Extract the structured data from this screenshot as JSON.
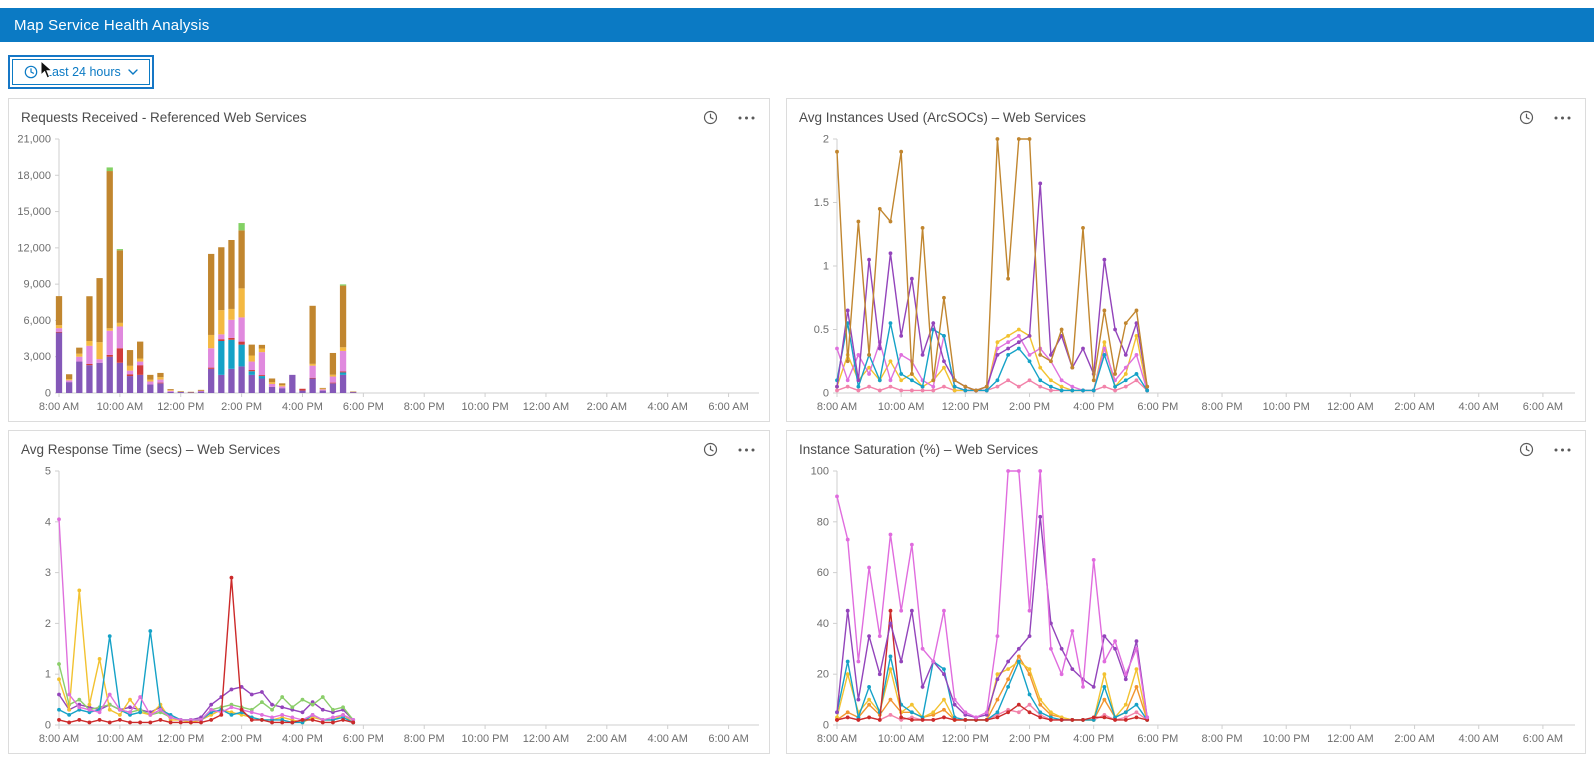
{
  "app": {
    "title": "Map Service Health Analysis"
  },
  "colors": {
    "header_bg": "#0b7ac4",
    "accent": "#0b7ac4",
    "axis": "#cfcfcf",
    "tick_text": "#6e6e6e"
  },
  "toolbar": {
    "time_filter_label": "Last 24 hours",
    "icons": {
      "clock": "clock-icon",
      "dropdown": "chevron-down-icon"
    }
  },
  "panel_icons": {
    "time": "clock-icon",
    "menu": "ellipsis-icon"
  },
  "chart_data": [
    {
      "type": "stacked-bar",
      "title": "Requests Received - Referenced Web Services",
      "ylim": [
        0,
        21000
      ],
      "yticks": [
        0,
        3000,
        6000,
        9000,
        12000,
        15000,
        18000,
        21000
      ],
      "ytick_labels": [
        "0",
        "3,000",
        "6,000",
        "9,000",
        "12,000",
        "15,000",
        "18,000",
        "21,000"
      ],
      "xtick_labels": [
        "8:00 AM",
        "10:00 AM",
        "12:00 PM",
        "2:00 PM",
        "4:00 PM",
        "6:00 PM",
        "8:00 PM",
        "10:00 PM",
        "12:00 AM",
        "2:00 AM",
        "4:00 AM",
        "6:00 AM"
      ],
      "tick_every": 12,
      "x_slots": 139,
      "data_start_slot": 0,
      "data_step": 2,
      "legend": "hidden",
      "grid": false,
      "series": [
        {
          "name": "purple",
          "color": "#8458b8",
          "values": [
            5000,
            900,
            2600,
            2300,
            2500,
            3000,
            2500,
            1400,
            1500,
            700,
            800,
            100,
            80,
            60,
            120,
            2000,
            1500,
            2000,
            2200,
            1500,
            1200,
            500,
            400,
            1500,
            200,
            1200,
            200,
            800,
            1500,
            80
          ]
        },
        {
          "name": "teal",
          "color": "#15a2c7",
          "values": [
            0,
            0,
            0,
            0,
            0,
            0,
            0,
            0,
            0,
            0,
            0,
            0,
            0,
            0,
            0,
            0,
            2800,
            2400,
            1800,
            300,
            200,
            0,
            0,
            0,
            0,
            0,
            0,
            0,
            200,
            0
          ]
        },
        {
          "name": "red",
          "color": "#d13b3b",
          "values": [
            60,
            0,
            0,
            100,
            0,
            150,
            1200,
            150,
            800,
            0,
            60,
            0,
            0,
            0,
            0,
            100,
            150,
            150,
            250,
            100,
            80,
            0,
            0,
            0,
            150,
            60,
            0,
            60,
            80,
            0
          ]
        },
        {
          "name": "orchid",
          "color": "#e089de",
          "values": [
            300,
            150,
            400,
            1500,
            300,
            2000,
            1800,
            300,
            300,
            250,
            250,
            80,
            0,
            0,
            60,
            1600,
            400,
            1500,
            2000,
            700,
            1900,
            250,
            150,
            0,
            0,
            1000,
            100,
            500,
            1700,
            0
          ]
        },
        {
          "name": "yellow",
          "color": "#f4b942",
          "values": [
            250,
            100,
            250,
            400,
            1400,
            200,
            300,
            400,
            250,
            150,
            200,
            60,
            0,
            0,
            0,
            1100,
            2000,
            900,
            2400,
            500,
            300,
            150,
            100,
            0,
            0,
            150,
            60,
            150,
            300,
            0
          ]
        },
        {
          "name": "tan",
          "color": "#c1862f",
          "values": [
            2400,
            400,
            500,
            3700,
            5300,
            13000,
            6000,
            1300,
            1400,
            400,
            350,
            80,
            60,
            40,
            80,
            6700,
            5200,
            5700,
            4800,
            900,
            300,
            300,
            150,
            0,
            0,
            4800,
            60,
            1800,
            5100,
            40
          ]
        },
        {
          "name": "green",
          "color": "#83d164",
          "values": [
            0,
            0,
            0,
            0,
            0,
            300,
            100,
            0,
            0,
            0,
            0,
            0,
            0,
            0,
            0,
            0,
            0,
            0,
            600,
            0,
            0,
            0,
            0,
            0,
            0,
            0,
            0,
            0,
            100,
            0
          ]
        }
      ]
    },
    {
      "type": "line",
      "title": "Avg Instances Used (ArcSOCs) – Web Services",
      "ylim": [
        0,
        2
      ],
      "yticks": [
        0,
        0.5,
        1,
        1.5,
        2
      ],
      "ytick_labels": [
        "0",
        "0.5",
        "1",
        "1.5",
        "2"
      ],
      "xtick_labels": [
        "8:00 AM",
        "10:00 AM",
        "12:00 PM",
        "2:00 PM",
        "4:00 PM",
        "6:00 PM",
        "8:00 PM",
        "10:00 PM",
        "12:00 AM",
        "2:00 AM",
        "4:00 AM",
        "6:00 AM"
      ],
      "tick_every": 12,
      "x_slots": 139,
      "data_start_slot": 0,
      "data_step": 2,
      "legend": "hidden",
      "grid": false,
      "series": [
        {
          "name": "pink",
          "color": "#f283aa",
          "values": [
            0.02,
            0.05,
            0.02,
            0.05,
            0.02,
            0.05,
            0.02,
            0.02,
            0.02,
            0.02,
            0.05,
            0.02,
            0.02,
            0.02,
            0.02,
            0.05,
            0.1,
            0.05,
            0.1,
            0.05,
            0.02,
            0.02,
            0.02,
            0.02,
            0.02,
            0.05,
            0.02,
            0.05,
            0.1,
            0.02
          ]
        },
        {
          "name": "yellow",
          "color": "#f2c230",
          "values": [
            0.05,
            0.3,
            0.1,
            0.2,
            0.1,
            0.25,
            0.1,
            0.15,
            0.05,
            0.1,
            0.2,
            0.02,
            0.02,
            0.02,
            0.02,
            0.4,
            0.45,
            0.5,
            0.45,
            0.2,
            0.1,
            0.05,
            0.02,
            0.02,
            0.02,
            0.4,
            0.05,
            0.15,
            0.45,
            0.02
          ]
        },
        {
          "name": "magenta",
          "color": "#df70dd",
          "values": [
            0.35,
            0.1,
            0.3,
            0.15,
            0.4,
            0.1,
            0.3,
            0.25,
            0.1,
            0.05,
            0.45,
            0.05,
            0.02,
            0.02,
            0.02,
            0.35,
            0.4,
            0.45,
            0.3,
            0.35,
            0.25,
            0.1,
            0.05,
            0.02,
            0.02,
            0.35,
            0.1,
            0.2,
            0.3,
            0.02
          ]
        },
        {
          "name": "teal",
          "color": "#15a2c7",
          "values": [
            0.1,
            0.55,
            0.05,
            0.3,
            0.1,
            0.55,
            0.15,
            0.1,
            0.05,
            0.5,
            0.45,
            0.05,
            0.02,
            0.02,
            0.02,
            0.1,
            0.3,
            0.35,
            0.25,
            0.1,
            0.05,
            0.02,
            0.02,
            0.02,
            0.02,
            0.3,
            0.05,
            0.1,
            0.15,
            0.02
          ]
        },
        {
          "name": "purple",
          "color": "#9344bb",
          "values": [
            0.05,
            0.65,
            0.1,
            1.05,
            0.35,
            1.1,
            0.45,
            0.9,
            0.3,
            0.55,
            0.25,
            0.1,
            0.05,
            0.02,
            0.05,
            0.3,
            0.35,
            0.4,
            0.45,
            1.65,
            0.3,
            0.45,
            0.2,
            0.35,
            0.15,
            1.05,
            0.5,
            0.3,
            0.55,
            0.05
          ]
        },
        {
          "name": "tan",
          "color": "#c1862f",
          "values": [
            1.9,
            0.25,
            1.35,
            0.3,
            1.45,
            1.35,
            1.9,
            0.15,
            1.3,
            0.1,
            0.75,
            0.1,
            0.05,
            0.02,
            0.05,
            2.0,
            0.9,
            2.0,
            2.0,
            0.3,
            0.25,
            0.5,
            0.2,
            1.3,
            0.1,
            0.65,
            0.15,
            0.55,
            0.65,
            0.05
          ]
        }
      ]
    },
    {
      "type": "line",
      "title": "Avg Response Time (secs) – Web Services",
      "ylim": [
        0,
        5
      ],
      "yticks": [
        0,
        1,
        2,
        3,
        4,
        5
      ],
      "ytick_labels": [
        "0",
        "1",
        "2",
        "3",
        "4",
        "5"
      ],
      "xtick_labels": [
        "8:00 AM",
        "10:00 AM",
        "12:00 PM",
        "2:00 PM",
        "4:00 PM",
        "6:00 PM",
        "8:00 PM",
        "10:00 PM",
        "12:00 AM",
        "2:00 AM",
        "4:00 AM",
        "6:00 AM"
      ],
      "tick_every": 12,
      "x_slots": 139,
      "data_start_slot": 0,
      "data_step": 2,
      "legend": "hidden",
      "grid": false,
      "series": [
        {
          "name": "purple",
          "color": "#9344bb",
          "values": [
            0.6,
            0.3,
            0.4,
            0.35,
            0.3,
            0.4,
            0.3,
            0.35,
            0.3,
            0.25,
            0.35,
            0.15,
            0.1,
            0.1,
            0.15,
            0.4,
            0.55,
            0.7,
            0.75,
            0.6,
            0.65,
            0.4,
            0.35,
            0.3,
            0.25,
            0.45,
            0.3,
            0.25,
            0.3,
            0.1
          ]
        },
        {
          "name": "green",
          "color": "#8bce6a",
          "values": [
            1.2,
            0.4,
            0.5,
            0.3,
            0.35,
            0.4,
            0.3,
            0.25,
            0.3,
            0.2,
            0.25,
            0.15,
            0.1,
            0.1,
            0.1,
            0.3,
            0.35,
            0.4,
            0.35,
            0.3,
            0.45,
            0.3,
            0.55,
            0.35,
            0.5,
            0.4,
            0.55,
            0.3,
            0.35,
            0.1
          ]
        },
        {
          "name": "yellow",
          "color": "#f2c230",
          "values": [
            0.9,
            0.3,
            2.65,
            0.4,
            1.3,
            0.3,
            0.2,
            0.5,
            0.25,
            0.2,
            0.4,
            0.1,
            0.1,
            0.05,
            0.1,
            0.2,
            0.3,
            0.25,
            0.2,
            0.15,
            0.1,
            0.1,
            0.15,
            0.1,
            0.05,
            0.15,
            0.1,
            0.1,
            0.2,
            0.05
          ]
        },
        {
          "name": "teal",
          "color": "#15a2c7",
          "values": [
            0.3,
            0.2,
            0.3,
            0.25,
            0.3,
            1.75,
            0.3,
            0.2,
            0.25,
            1.85,
            0.3,
            0.2,
            0.1,
            0.1,
            0.1,
            0.25,
            0.3,
            0.2,
            0.25,
            0.15,
            0.1,
            0.1,
            0.1,
            0.05,
            0.05,
            0.2,
            0.1,
            0.1,
            0.15,
            0.05
          ]
        },
        {
          "name": "magenta",
          "color": "#df70dd",
          "values": [
            4.05,
            0.6,
            0.35,
            0.3,
            0.25,
            0.6,
            0.3,
            0.25,
            0.55,
            0.2,
            0.3,
            0.15,
            0.1,
            0.1,
            0.1,
            0.3,
            0.25,
            0.35,
            0.3,
            0.25,
            0.2,
            0.15,
            0.2,
            0.15,
            0.1,
            0.2,
            0.1,
            0.15,
            0.2,
            0.1
          ]
        },
        {
          "name": "red",
          "color": "#cc2a2a",
          "values": [
            0.1,
            0.05,
            0.1,
            0.05,
            0.1,
            0.05,
            0.1,
            0.05,
            0.05,
            0.05,
            0.1,
            0.05,
            0.05,
            0.05,
            0.05,
            0.1,
            0.2,
            2.9,
            0.3,
            0.1,
            0.1,
            0.05,
            0.05,
            0.05,
            0.1,
            0.1,
            0.05,
            0.05,
            0.1,
            0.05
          ]
        }
      ]
    },
    {
      "type": "line",
      "title": "Instance Saturation (%) – Web Services",
      "ylim": [
        0,
        100
      ],
      "yticks": [
        0,
        20,
        40,
        60,
        80,
        100
      ],
      "ytick_labels": [
        "0",
        "20",
        "40",
        "60",
        "80",
        "100"
      ],
      "xtick_labels": [
        "8:00 AM",
        "10:00 AM",
        "12:00 PM",
        "2:00 PM",
        "4:00 PM",
        "6:00 PM",
        "8:00 PM",
        "10:00 PM",
        "12:00 AM",
        "2:00 AM",
        "4:00 AM",
        "6:00 AM"
      ],
      "tick_every": 12,
      "x_slots": 139,
      "data_start_slot": 0,
      "data_step": 2,
      "legend": "hidden",
      "grid": false,
      "series": [
        {
          "name": "pink",
          "color": "#f283aa",
          "values": [
            2,
            3,
            2,
            3,
            2,
            4,
            2,
            3,
            2,
            2,
            3,
            2,
            2,
            2,
            2,
            4,
            6,
            5,
            8,
            4,
            2,
            2,
            2,
            2,
            2,
            4,
            2,
            3,
            5,
            2
          ]
        },
        {
          "name": "orange",
          "color": "#f2952f",
          "values": [
            2,
            5,
            3,
            8,
            4,
            10,
            5,
            5,
            3,
            4,
            6,
            2,
            2,
            2,
            2,
            10,
            18,
            27,
            20,
            8,
            4,
            3,
            2,
            2,
            2,
            10,
            3,
            5,
            15,
            2
          ]
        },
        {
          "name": "yellow",
          "color": "#f2c230",
          "values": [
            3,
            20,
            5,
            10,
            5,
            22,
            5,
            8,
            3,
            5,
            10,
            2,
            2,
            2,
            2,
            20,
            22,
            25,
            22,
            10,
            5,
            3,
            2,
            2,
            2,
            20,
            3,
            8,
            22,
            2
          ]
        },
        {
          "name": "teal",
          "color": "#15a2c7",
          "values": [
            5,
            25,
            3,
            15,
            5,
            27,
            8,
            5,
            3,
            25,
            22,
            3,
            2,
            2,
            2,
            5,
            15,
            25,
            12,
            5,
            3,
            2,
            2,
            2,
            2,
            15,
            3,
            5,
            8,
            2
          ]
        },
        {
          "name": "red",
          "color": "#cc2a2a",
          "values": [
            2,
            3,
            2,
            3,
            2,
            45,
            3,
            2,
            2,
            2,
            3,
            2,
            2,
            2,
            2,
            3,
            5,
            8,
            5,
            3,
            2,
            2,
            2,
            2,
            3,
            3,
            2,
            2,
            3,
            2
          ]
        },
        {
          "name": "purple",
          "color": "#9344bb",
          "values": [
            5,
            45,
            10,
            35,
            20,
            40,
            25,
            45,
            15,
            25,
            20,
            8,
            4,
            3,
            4,
            18,
            25,
            30,
            35,
            82,
            40,
            30,
            22,
            18,
            15,
            35,
            30,
            18,
            33,
            3
          ]
        },
        {
          "name": "violet",
          "color": "#e06cde",
          "values": [
            90,
            73,
            25,
            62,
            35,
            75,
            45,
            71,
            30,
            25,
            45,
            10,
            5,
            3,
            5,
            35,
            100,
            100,
            45,
            100,
            30,
            20,
            37,
            15,
            65,
            25,
            33,
            20,
            30,
            3
          ]
        }
      ]
    }
  ]
}
